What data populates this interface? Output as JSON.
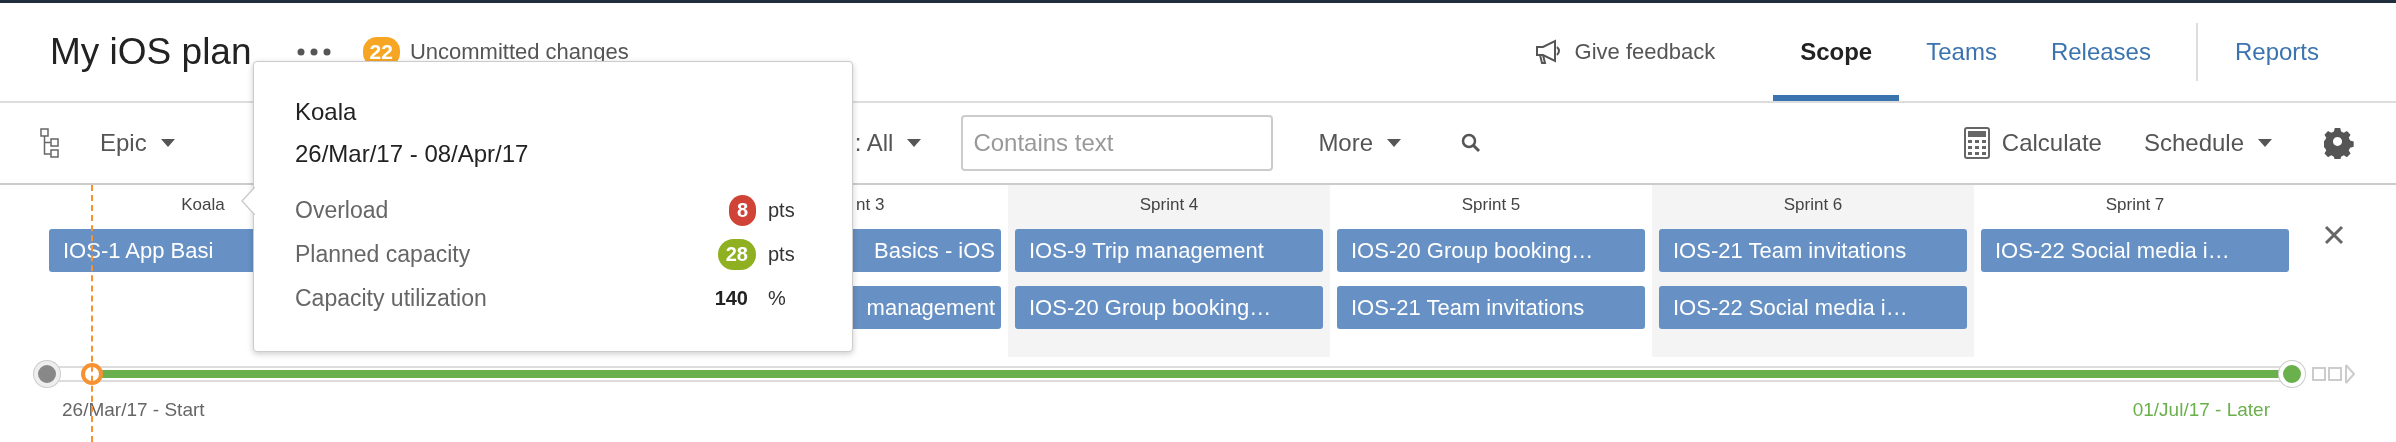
{
  "plan": {
    "title": "My iOS plan",
    "changes_count": "22",
    "changes_label": "Uncommitted changes"
  },
  "feedback": "Give feedback",
  "tabs": [
    {
      "label": "Scope",
      "selected": true
    },
    {
      "label": "Teams",
      "selected": false
    },
    {
      "label": "Releases",
      "selected": false
    },
    {
      "label": "Reports",
      "selected": false
    }
  ],
  "toolbar": {
    "group_by": "Epic",
    "filter": ": All",
    "search": {
      "placeholder": "Contains text"
    },
    "more": "More",
    "calculate": "Calculate",
    "schedule": "Schedule"
  },
  "sprints": [
    {
      "name": "Koala",
      "kind": "covered",
      "cards": [
        "IOS-1 App Basi"
      ]
    },
    {
      "name": "nt 3",
      "kind": "partial",
      "cards": [
        "Basics - iOS",
        "management"
      ]
    },
    {
      "name": "Sprint 4",
      "kind": "full",
      "cards": [
        "IOS-9 Trip management",
        "IOS-20 Group booking…"
      ]
    },
    {
      "name": "Sprint 5",
      "kind": "full",
      "cards": [
        "IOS-20 Group booking…",
        "IOS-21 Team invitations"
      ]
    },
    {
      "name": "Sprint 6",
      "kind": "full",
      "cards": [
        "IOS-21 Team invitations",
        "IOS-22 Social media i…"
      ]
    },
    {
      "name": "Sprint 7",
      "kind": "full",
      "cards": [
        "IOS-22 Social media i…"
      ]
    }
  ],
  "timeline": {
    "start_label": "26/Mar/17 - Start",
    "end_label": "01/Jul/17 - Later"
  },
  "tooltip": {
    "title": "Koala",
    "dates": "26/Mar/17 - 08/Apr/17",
    "metrics": [
      {
        "label": "Overload",
        "value": "8",
        "unit": "pts",
        "kind": "danger"
      },
      {
        "label": "Planned capacity",
        "value": "28",
        "unit": "pts",
        "kind": "success"
      },
      {
        "label": "Capacity utilization",
        "value": "140",
        "unit": "%",
        "kind": "plain"
      }
    ]
  }
}
